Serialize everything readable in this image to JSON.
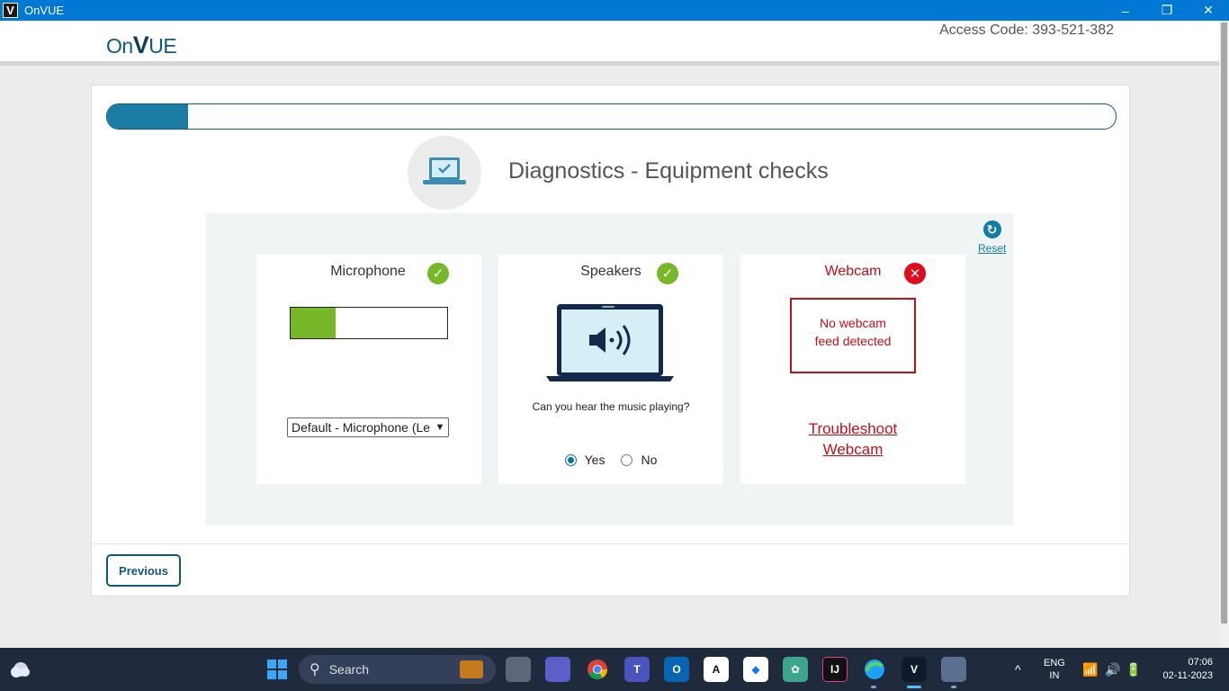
{
  "window": {
    "app_icon": "V",
    "title": "OnVUE",
    "minimize": "–",
    "restore": "❐",
    "close": "✕"
  },
  "header": {
    "logo_prefix": "On",
    "logo_v": "V",
    "logo_suffix": "UE",
    "access_code": "Access Code: 393-521-382"
  },
  "progress": {
    "value": 0.08
  },
  "page": {
    "title": "Diagnostics - Equipment checks",
    "reset_label": "Reset"
  },
  "microphone": {
    "title": "Microphone",
    "status": "ok",
    "level": 0.29,
    "selected_device": "Default - Microphone (Le"
  },
  "speakers": {
    "title": "Speakers",
    "status": "ok",
    "question": "Can you hear the music playing?",
    "options": [
      "Yes",
      "No"
    ],
    "selected": "Yes"
  },
  "webcam": {
    "title": "Webcam",
    "status": "fail",
    "message_line1": "No webcam",
    "message_line2": "feed detected",
    "troubleshoot_line1": "Troubleshoot",
    "troubleshoot_line2": "Webcam"
  },
  "footer": {
    "previous_label": "Previous"
  },
  "taskbar": {
    "search_label": "Search",
    "language": "ENG",
    "region": "IN",
    "time": "07:06",
    "date": "02-11-2023",
    "colors": {
      "background": "#1f2a3c",
      "accent": "#0078d4"
    }
  }
}
